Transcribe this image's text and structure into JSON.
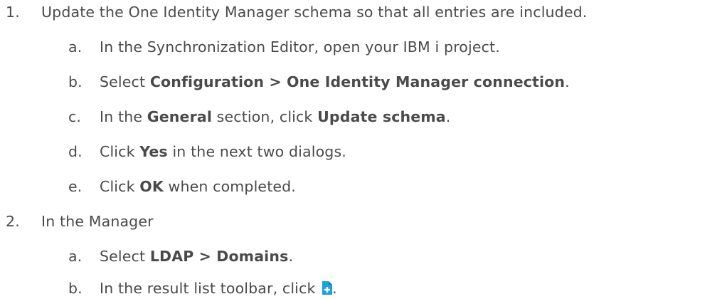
{
  "steps": [
    {
      "number": "1.",
      "text": "Update the One Identity Manager schema so that all entries are included.",
      "substeps": [
        {
          "letter": "a.",
          "text": "In the Synchronization Editor, open your IBM i project."
        },
        {
          "letter": "b.",
          "pre": "Select ",
          "bold": "Configuration > One Identity Manager connection",
          "post": "."
        },
        {
          "letter": "c.",
          "pre": "In the ",
          "bold": "General",
          "mid": " section, click ",
          "bold2": "Update schema",
          "post": "."
        },
        {
          "letter": "d.",
          "pre": "Click ",
          "bold": "Yes",
          "post": " in the next two dialogs."
        },
        {
          "letter": "e.",
          "pre": "Click ",
          "bold": "OK",
          "post": " when completed."
        }
      ]
    },
    {
      "number": "2.",
      "text": "In the Manager",
      "substeps": [
        {
          "letter": "a.",
          "pre": "Select ",
          "bold": "LDAP > Domains",
          "post": "."
        },
        {
          "letter": "b.",
          "pre": "In the result list toolbar, click ",
          "icon": "add-document-icon",
          "post": "."
        }
      ]
    }
  ],
  "colors": {
    "text": "#4a4a4a",
    "icon_primary": "#1aa3d9",
    "icon_accent": "#ffffff"
  }
}
